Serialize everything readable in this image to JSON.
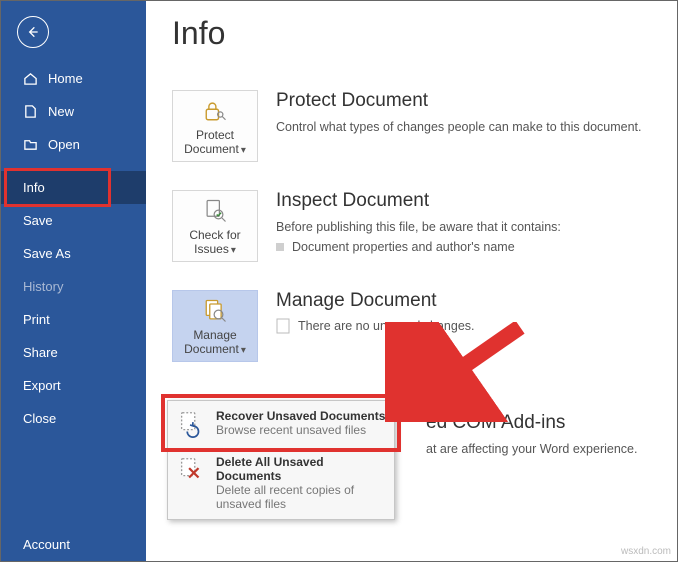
{
  "sidebar": {
    "items": [
      {
        "label": "Home"
      },
      {
        "label": "New"
      },
      {
        "label": "Open"
      },
      {
        "label": "Info"
      },
      {
        "label": "Save"
      },
      {
        "label": "Save As"
      },
      {
        "label": "History"
      },
      {
        "label": "Print"
      },
      {
        "label": "Share"
      },
      {
        "label": "Export"
      },
      {
        "label": "Close"
      }
    ],
    "footer": {
      "account": "Account"
    }
  },
  "page": {
    "title": "Info"
  },
  "protect": {
    "tile_label": "Protect Document",
    "title": "Protect Document",
    "desc": "Control what types of changes people can make to this document."
  },
  "inspect": {
    "tile_label": "Check for Issues",
    "title": "Inspect Document",
    "desc": "Before publishing this file, be aware that it contains:",
    "bullet": "Document properties and author's name"
  },
  "manage": {
    "tile_label": "Manage Document",
    "title": "Manage Document",
    "desc": "There are no unsaved changes."
  },
  "addins": {
    "title_suffix": "ed COM Add-ins",
    "desc_suffix": "at are affecting your Word experience."
  },
  "dropdown": {
    "recover_title": "Recover Unsaved Documents",
    "recover_sub": "Browse recent unsaved files",
    "delete_title": "Delete All Unsaved Documents",
    "delete_sub": "Delete all recent copies of unsaved files"
  },
  "watermark": "wsxdn.com"
}
